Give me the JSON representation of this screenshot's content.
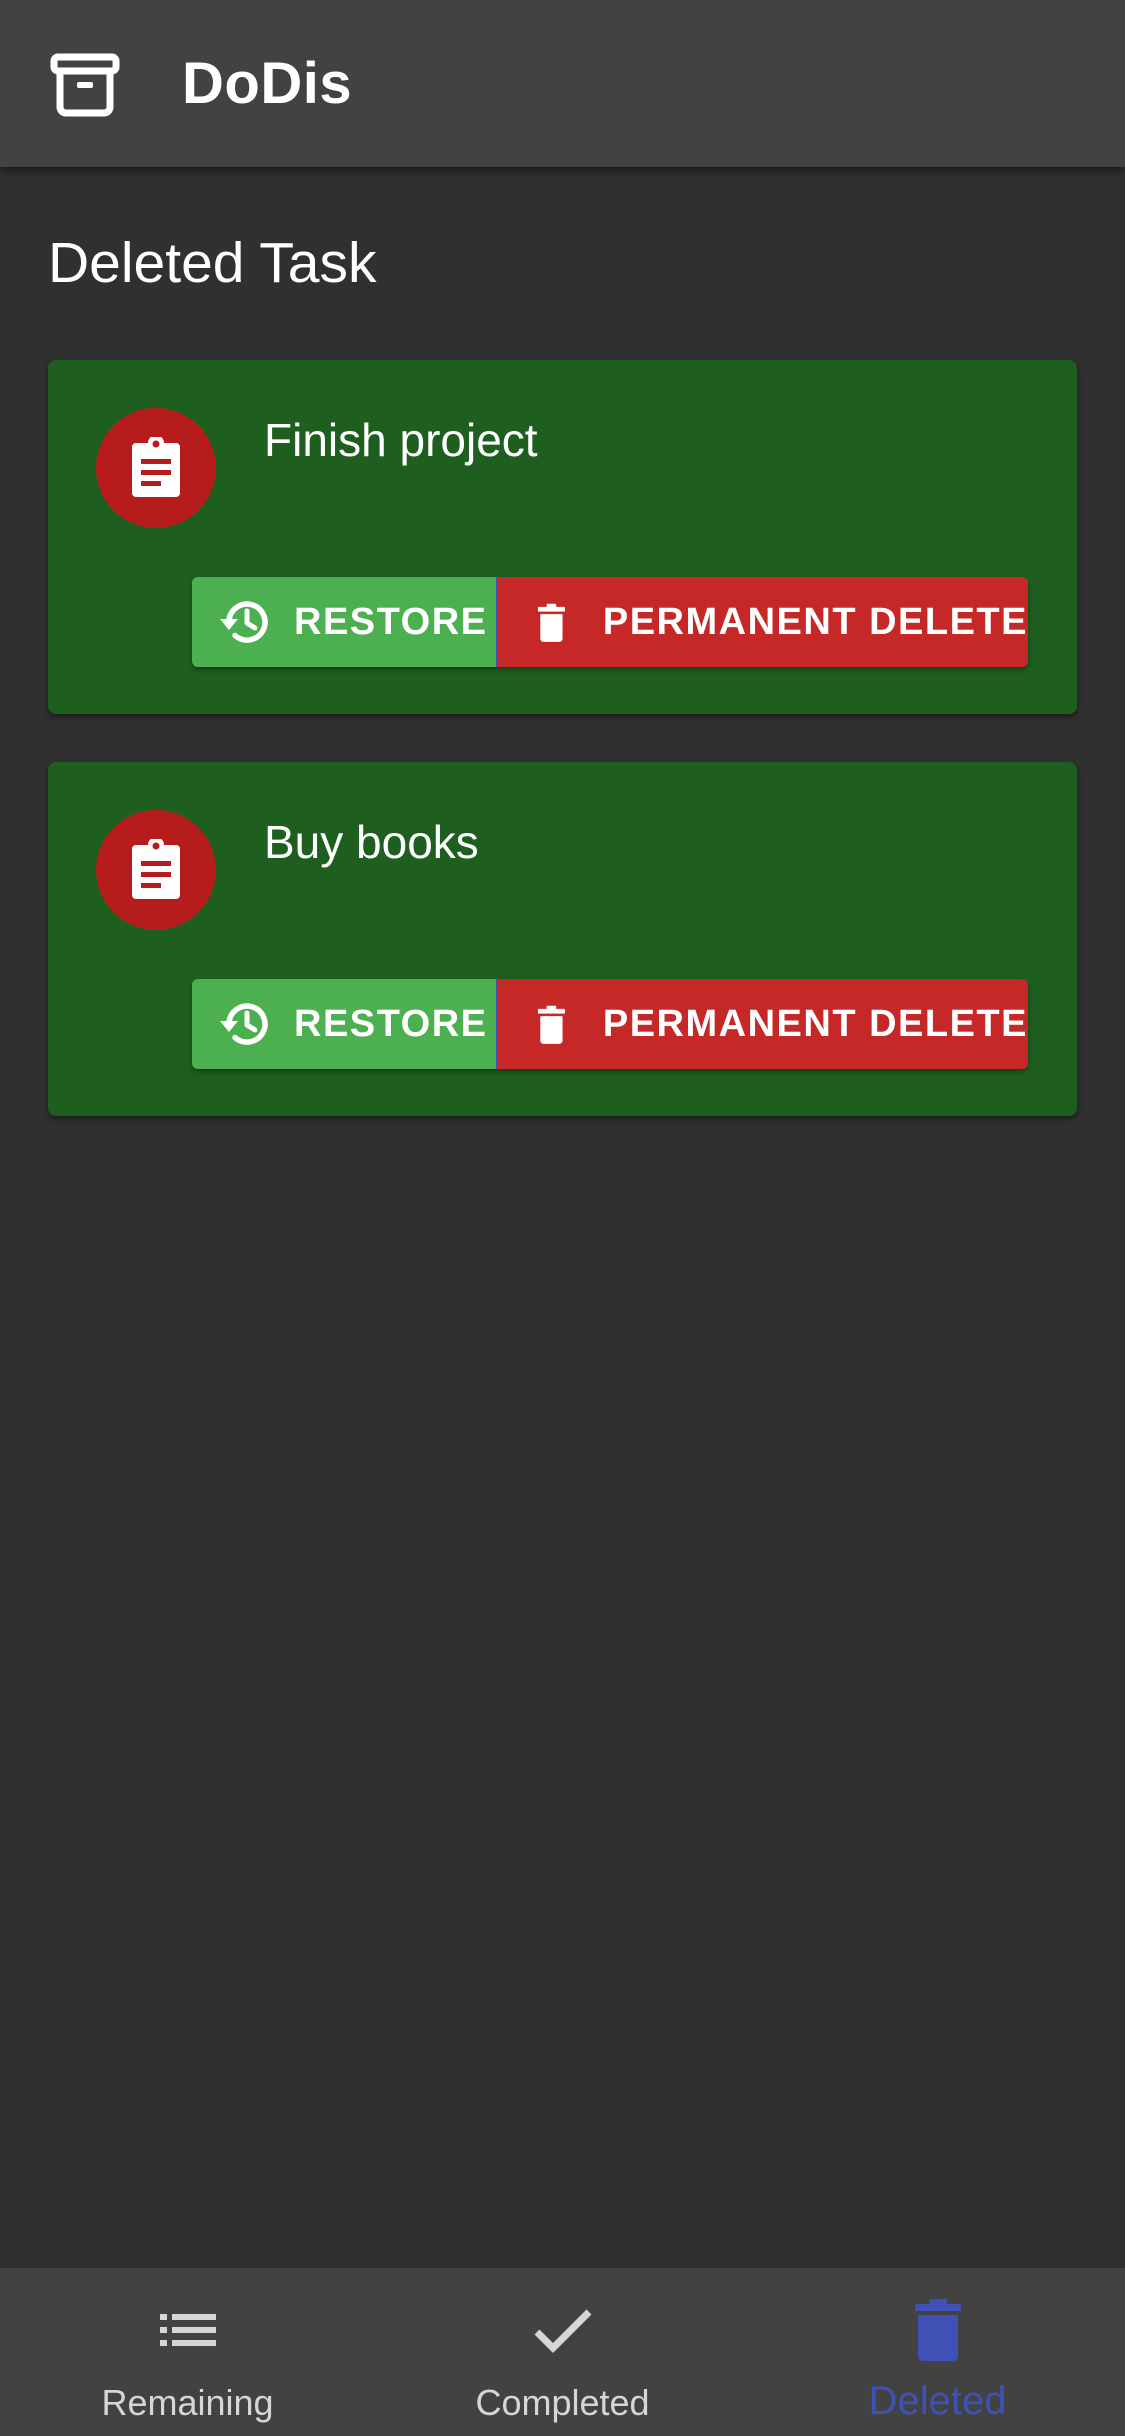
{
  "app": {
    "title": "DoDis",
    "logo_icon": "archive-box-icon"
  },
  "page": {
    "title": "Deleted Task"
  },
  "tasks": [
    {
      "name": "Finish project",
      "icon": "clipboard-icon",
      "restore_label": "RESTORE",
      "delete_label": "PERMANENT DELETE"
    },
    {
      "name": "Buy books",
      "icon": "clipboard-icon",
      "restore_label": "RESTORE",
      "delete_label": "PERMANENT DELETE"
    }
  ],
  "bottom_nav": {
    "items": [
      {
        "label": "Remaining",
        "icon": "list-icon",
        "active": false
      },
      {
        "label": "Completed",
        "icon": "check-icon",
        "active": false
      },
      {
        "label": "Deleted",
        "icon": "trash-icon",
        "active": true
      }
    ]
  },
  "colors": {
    "background": "#303030",
    "app_bar": "#424242",
    "card": "#1e5f20",
    "restore": "#4caf50",
    "delete": "#c62828",
    "avatar": "#b71c1c",
    "active_nav": "#3f51b5"
  }
}
